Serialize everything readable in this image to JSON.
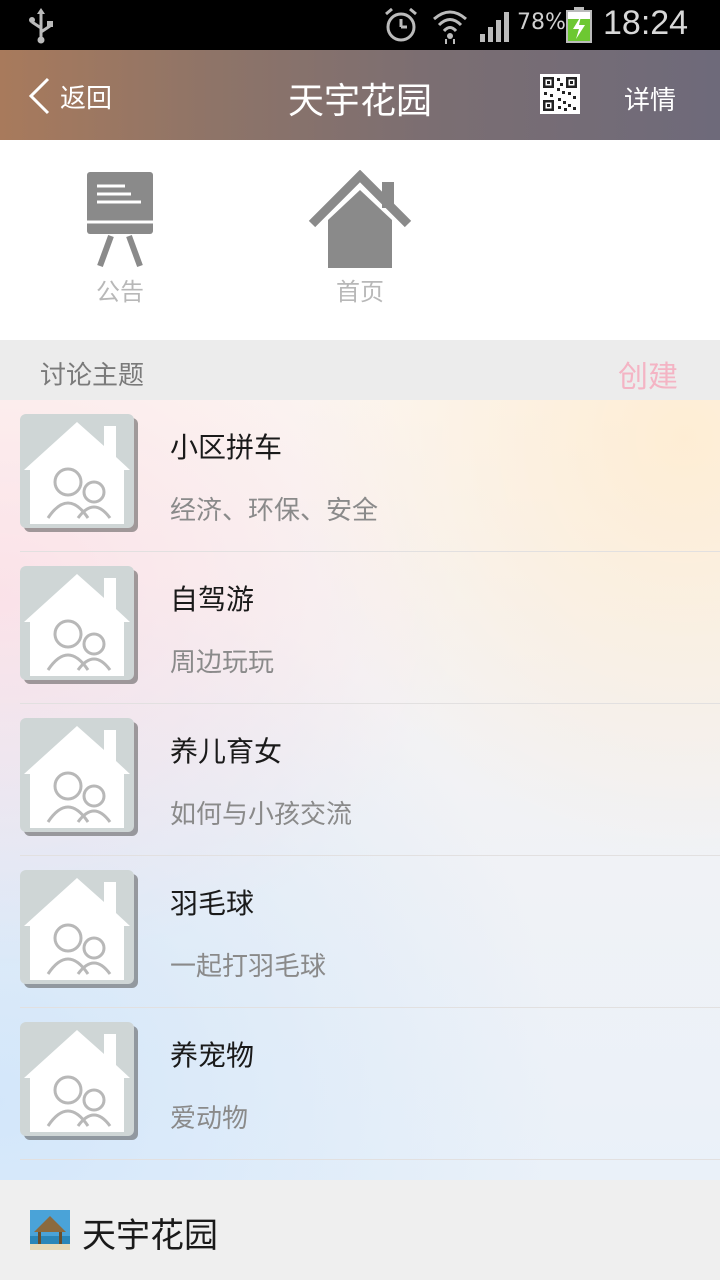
{
  "status_bar": {
    "battery_percent": "78%",
    "time": "18:24",
    "icons": [
      "usb-icon",
      "alarm-icon",
      "wifi-icon",
      "signal-icon",
      "battery-charging-icon"
    ]
  },
  "header": {
    "back_label": "返回",
    "title": "天宇花园",
    "detail_label": "详情",
    "qr_icon": "qr-code-icon",
    "background_colors": [
      "#a87a5c",
      "#6e6a7a"
    ]
  },
  "shortcuts": [
    {
      "label": "公告",
      "icon": "notice-board-icon"
    },
    {
      "label": "首页",
      "icon": "home-icon"
    }
  ],
  "section": {
    "title": "讨论主题",
    "create_label": "创建",
    "create_color": "#f4b4c4"
  },
  "topics": [
    {
      "title": "小区拼车",
      "subtitle": "经济、环保、安全"
    },
    {
      "title": "自驾游",
      "subtitle": "周边玩玩"
    },
    {
      "title": "养儿育女",
      "subtitle": "如何与小孩交流"
    },
    {
      "title": "羽毛球",
      "subtitle": "一起打羽毛球"
    },
    {
      "title": "养宠物",
      "subtitle": "爱动物"
    }
  ],
  "footer": {
    "title": "天宇花园",
    "image": "community-thumbnail"
  }
}
